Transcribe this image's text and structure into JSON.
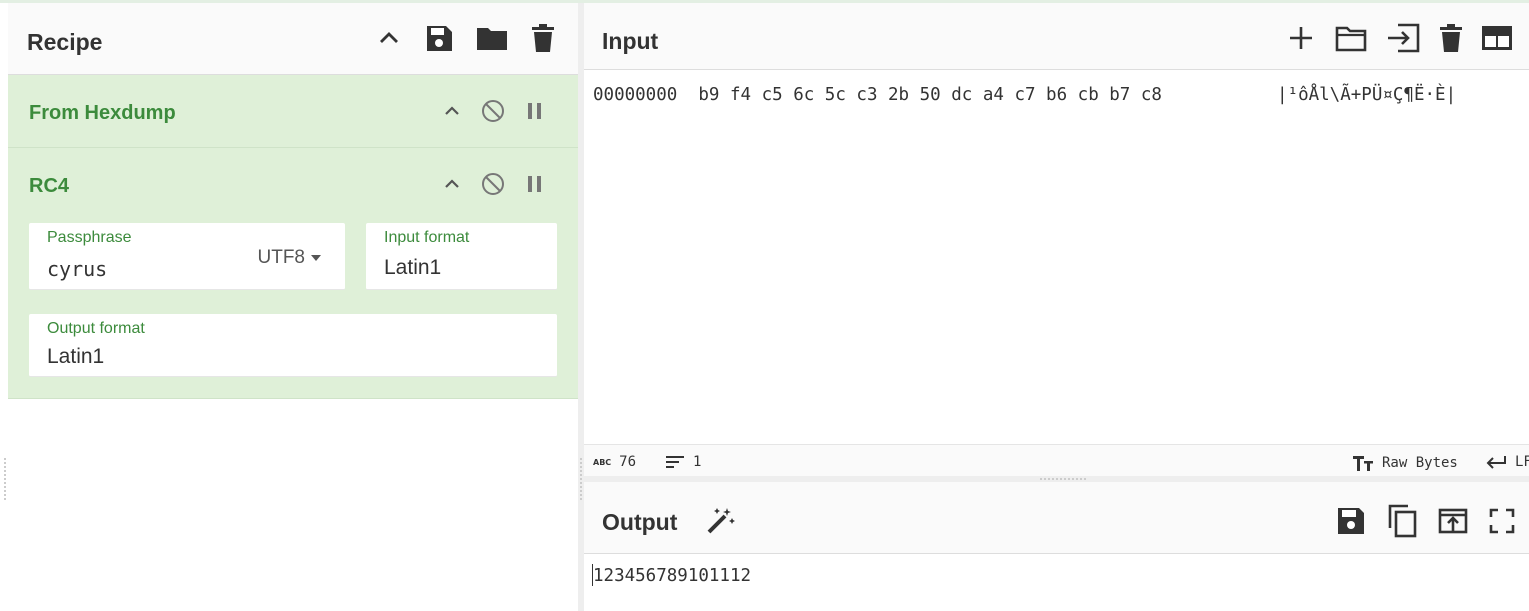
{
  "recipe": {
    "title": "Recipe",
    "operations": [
      {
        "name": "From Hexdump"
      },
      {
        "name": "RC4",
        "passphrase": {
          "label": "Passphrase",
          "value": "cyrus",
          "encoding": "UTF8"
        },
        "input_format": {
          "label": "Input format",
          "value": "Latin1"
        },
        "output_format": {
          "label": "Output format",
          "value": "Latin1"
        }
      }
    ]
  },
  "input": {
    "title": "Input",
    "hex_offset": "00000000",
    "hex_bytes": "b9 f4 c5 6c 5c c3 2b 50 dc a4 c7 b6 cb b7 c8",
    "hex_chars": "|¹ôÅl\\Ã+PÜ¤Ç¶Ë·È|",
    "status": {
      "char_icon": "ABC",
      "length": "76",
      "lines": "1",
      "encoding": "Raw Bytes",
      "eol": "LF"
    }
  },
  "output": {
    "title": "Output",
    "text": "123456789101112"
  },
  "colors": {
    "accent_green": "#3c8b3c",
    "operation_bg": "#dff0d8"
  }
}
